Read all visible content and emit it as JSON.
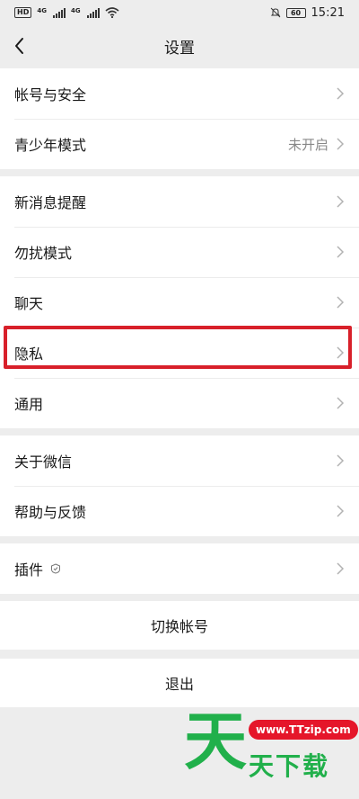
{
  "status_bar": {
    "left_badge": "HD",
    "net1": "4G",
    "net2": "4G",
    "battery": "60",
    "time": "15:21"
  },
  "nav": {
    "title": "设置"
  },
  "groups": {
    "g1": [
      {
        "label": "帐号与安全"
      },
      {
        "label": "青少年模式",
        "value": "未开启"
      }
    ],
    "g2": [
      {
        "label": "新消息提醒"
      },
      {
        "label": "勿扰模式"
      },
      {
        "label": "聊天"
      },
      {
        "label": "隐私"
      },
      {
        "label": "通用"
      }
    ],
    "g3": [
      {
        "label": "关于微信"
      },
      {
        "label": "帮助与反馈"
      }
    ],
    "g4": [
      {
        "label": "插件"
      }
    ]
  },
  "buttons": {
    "switch_account": "切换帐号",
    "logout": "退出"
  },
  "watermark": {
    "big": "天",
    "url": "www.TTzip.com",
    "text": "天下载"
  },
  "colors": {
    "background": "#ededed",
    "highlight": "#d8202a",
    "watermark_green": "#21b04b",
    "watermark_red": "#e5162a"
  }
}
